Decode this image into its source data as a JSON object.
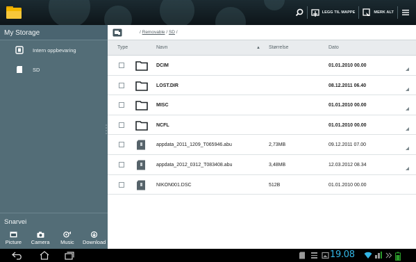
{
  "topbar": {
    "actions": [
      {
        "label": "",
        "icon": "search-icon"
      },
      {
        "label": "LEGG TIL MAPPE",
        "icon": "add-folder-icon"
      },
      {
        "label": "MERK ALT",
        "icon": "select-all-icon"
      },
      {
        "label": "",
        "icon": "overflow-menu-icon"
      }
    ]
  },
  "sidebar": {
    "title": "My Storage",
    "items": [
      {
        "label": "Intern oppbevaring",
        "icon": "internal-storage-icon"
      },
      {
        "label": "SD",
        "icon": "sd-card-icon"
      }
    ],
    "shortcut_title": "Snarvei",
    "shortcuts": [
      {
        "label": "Picture",
        "icon": "picture-icon"
      },
      {
        "label": "Camera",
        "icon": "camera-icon"
      },
      {
        "label": "Music",
        "icon": "music-icon"
      },
      {
        "label": "Download",
        "icon": "download-icon"
      }
    ]
  },
  "path": {
    "prefix": "/",
    "segments": [
      "Removable",
      "SD"
    ],
    "separator": "/"
  },
  "columns": {
    "type": "Type",
    "name": "Navn",
    "size": "Størrelse",
    "date": "Dato",
    "sort_indicator": "▲"
  },
  "files": [
    {
      "kind": "folder",
      "name": "DCIM",
      "size": "",
      "date": "01.01.2010 00.00"
    },
    {
      "kind": "folder",
      "name": "LOST.DIR",
      "size": "",
      "date": "08.12.2011 06.40"
    },
    {
      "kind": "folder",
      "name": "MISC",
      "size": "",
      "date": "01.01.2010 00.00"
    },
    {
      "kind": "folder",
      "name": "NCFL",
      "size": "",
      "date": "01.01.2010 00.00"
    },
    {
      "kind": "file",
      "name": "appdata_2011_1209_T065946.abu",
      "size": "2,73MB",
      "date": "09.12.2011 07.00"
    },
    {
      "kind": "file",
      "name": "appdata_2012_0312_T083408.abu",
      "size": "3,48MB",
      "date": "12.03.2012 08.34"
    },
    {
      "kind": "file",
      "name": "NIKON001.DSC",
      "size": "512B",
      "date": "01.01.2010 00.00"
    }
  ],
  "statusbar": {
    "clock": "19.08"
  },
  "colors": {
    "sidebar": "#536d77",
    "clock": "#33b5e5",
    "topbar": "#142026"
  }
}
